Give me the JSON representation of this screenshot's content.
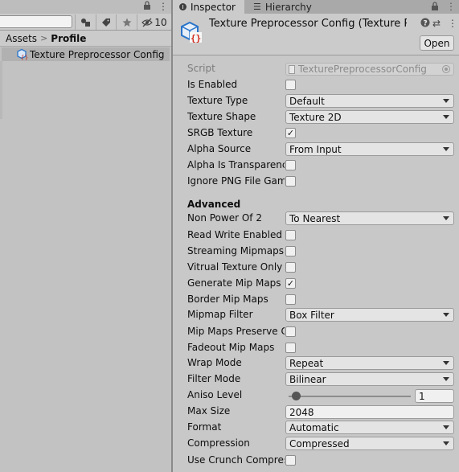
{
  "project": {
    "menu_glyph": "⋮",
    "lock_glyph": "🔒",
    "toolbar": {
      "search_placeholder": "",
      "hidden_count": "10"
    },
    "breadcrumb": {
      "root": "Assets",
      "separator": ">",
      "current": "Profile"
    },
    "asset": {
      "name": "Texture Preprocessor Config",
      "icon": "scriptable-object-icon"
    }
  },
  "inspector": {
    "tabs": [
      {
        "label": "Inspector",
        "icon": "info-icon"
      },
      {
        "label": "Hierarchy",
        "icon": "hierarchy-icon"
      }
    ],
    "tab_tools": {
      "lock": "🔒",
      "menu": "⋮"
    },
    "header": {
      "title": "Texture Preprocessor Config (Texture Preprocessor Config)",
      "icons": {
        "help": "?",
        "settings": "⇄",
        "menu": "⋮"
      },
      "open_label": "Open"
    },
    "script": {
      "label": "Script",
      "value": "TexturePreprocessorConfig"
    },
    "fields": {
      "is_enabled": {
        "label": "Is Enabled",
        "checked": false
      },
      "texture_type": {
        "label": "Texture Type",
        "value": "Default"
      },
      "texture_shape": {
        "label": "Texture Shape",
        "value": "Texture 2D"
      },
      "srgb": {
        "label": "SRGB Texture",
        "checked": true
      },
      "alpha_source": {
        "label": "Alpha Source",
        "value": "From Input"
      },
      "alpha_transparency": {
        "label": "Alpha Is Transparency",
        "checked": false
      },
      "ignore_png": {
        "label": "Ignore PNG File Gamma",
        "checked": false
      }
    },
    "advanced": {
      "title": "Advanced",
      "non_power_of_2": {
        "label": "Non Power Of 2",
        "value": "To Nearest"
      },
      "read_write": {
        "label": "Read Write Enabled",
        "checked": false
      },
      "streaming_mipmaps": {
        "label": "Streaming Mipmaps",
        "checked": false
      },
      "virtual_texture": {
        "label": "Vitrual Texture Only",
        "checked": false
      },
      "generate_mips": {
        "label": "Generate Mip Maps",
        "checked": true
      },
      "border_mips": {
        "label": "Border Mip Maps",
        "checked": false
      },
      "mipmap_filter": {
        "label": "Mipmap Filter",
        "value": "Box Filter"
      },
      "mip_preserve": {
        "label": "Mip Maps Preserve Coverage",
        "checked": false
      },
      "fadeout_mips": {
        "label": "Fadeout Mip Maps",
        "checked": false
      },
      "wrap_mode": {
        "label": "Wrap Mode",
        "value": "Repeat"
      },
      "filter_mode": {
        "label": "Filter Mode",
        "value": "Bilinear"
      },
      "aniso_level": {
        "label": "Aniso Level",
        "value": "1",
        "slider_fraction": 0.06
      },
      "max_size": {
        "label": "Max Size",
        "value": "2048"
      },
      "format": {
        "label": "Format",
        "value": "Automatic"
      },
      "compression": {
        "label": "Compression",
        "value": "Compressed"
      },
      "crunch": {
        "label": "Use Crunch Compression",
        "checked": false
      }
    }
  }
}
